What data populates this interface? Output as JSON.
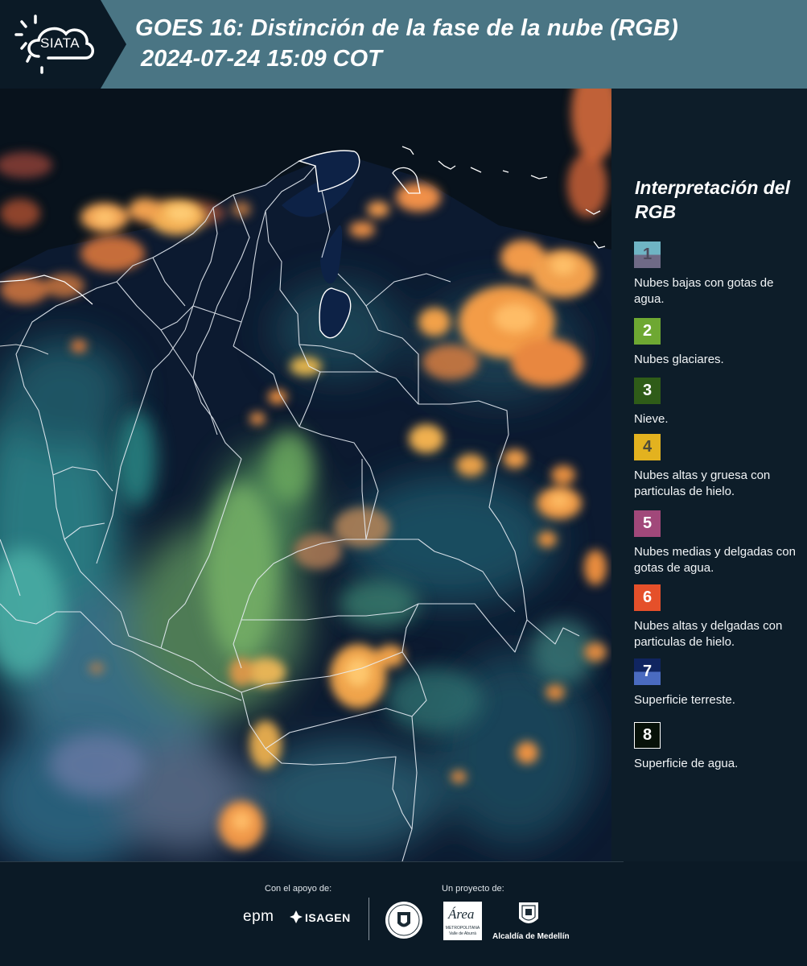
{
  "header": {
    "logo_text": "SIATA",
    "title": "GOES 16: Distinción de la fase de la nube (RGB)",
    "subtitle": "2024-07-24 15:09 COT"
  },
  "legend": {
    "title": "Interpretación del RGB",
    "items": [
      {
        "number": "1",
        "label": "Nubes bajas con gotas de agua.",
        "colors": [
          "#6fb4c4",
          "#6f6a86"
        ],
        "number_color": "#4d4a5c"
      },
      {
        "number": "2",
        "label": "Nubes glaciares.",
        "colors": [
          "#6ea832"
        ],
        "number_color": "#ffffff"
      },
      {
        "number": "3",
        "label": "Nieve.",
        "colors": [
          "#2f5c18"
        ],
        "number_color": "#ffffff"
      },
      {
        "number": "4",
        "label": "Nubes altas y gruesa con particulas de hielo.",
        "colors": [
          "#e3b21f"
        ],
        "number_color": "#4d4a3a"
      },
      {
        "number": "5",
        "label": "Nubes medias y delgadas con gotas de agua.",
        "colors": [
          "#a1487a"
        ],
        "number_color": "#ffffff"
      },
      {
        "number": "6",
        "label": "Nubes altas y delgadas con particulas de hielo.",
        "colors": [
          "#e5502a"
        ],
        "number_color": "#ffffff"
      },
      {
        "number": "7",
        "label": "Superficie terreste.",
        "colors": [
          "#102560",
          "#4a6bc0"
        ],
        "number_color": "#ffffff"
      },
      {
        "number": "8",
        "label": "Superficie de agua.",
        "colors": [
          "#071109"
        ],
        "number_color": "#ffffff"
      }
    ]
  },
  "footer": {
    "support_caption": "Con el apoyo de:",
    "project_caption": "Un proyecto de:",
    "sponsor_1": "epm",
    "sponsor_2": "ISAGEN",
    "partner_1": "Área",
    "partner_1_sub": "METROPOLITANA",
    "partner_1_sub2": "Valle de Aburrá",
    "partner_2": "Alcaldía de Medellín"
  }
}
